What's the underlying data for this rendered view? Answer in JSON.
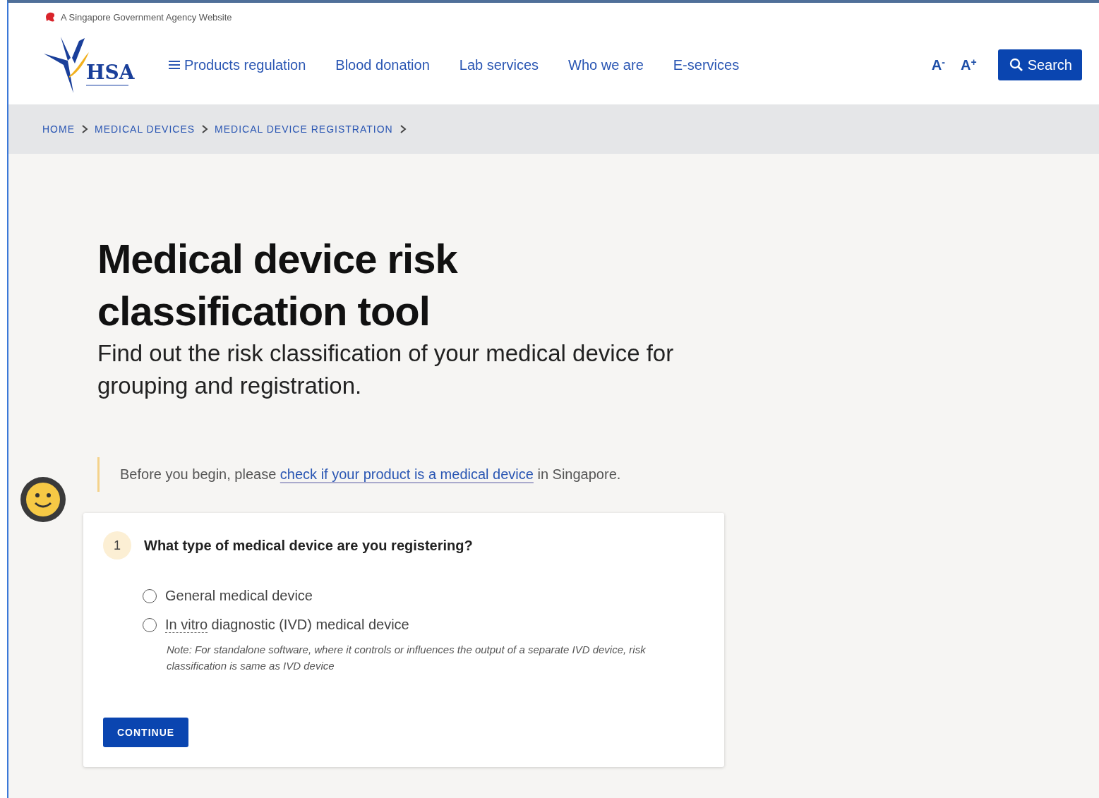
{
  "masthead": {
    "text": "A Singapore Government Agency Website"
  },
  "logo": {
    "acronym": "HSA"
  },
  "nav": [
    {
      "label": "Products regulation",
      "kind": "menu"
    },
    {
      "label": "Blood donation",
      "kind": "link"
    },
    {
      "label": "Lab services",
      "kind": "link"
    },
    {
      "label": "Who we are",
      "kind": "link"
    },
    {
      "label": "E-services",
      "kind": "link"
    }
  ],
  "font_controls": [
    {
      "label": "A",
      "sign": "-"
    },
    {
      "label": "A",
      "sign": "+"
    }
  ],
  "search_button": {
    "label": "Search"
  },
  "breadcrumb": [
    "HOME",
    "MEDICAL DEVICES",
    "MEDICAL DEVICE REGISTRATION"
  ],
  "title": "Medical device risk classification tool",
  "subtitle": "Find out the risk classification of your medical device for grouping and registration.",
  "callout": {
    "before": "Before you begin, please ",
    "link": "check if your product is a medical device",
    "after": " in Singapore."
  },
  "question": {
    "number": "1",
    "text": "What type of medical device are you registering?",
    "options": [
      {
        "label": "General medical device",
        "selected": false
      },
      {
        "term": "In vitro",
        "label": " diagnostic (IVD) medical device",
        "selected": false
      }
    ],
    "note": "Note: For standalone software, where it controls or influences the output of a separate IVD device, risk classification is same as IVD device"
  },
  "continue_button": {
    "label": "CONTINUE"
  }
}
